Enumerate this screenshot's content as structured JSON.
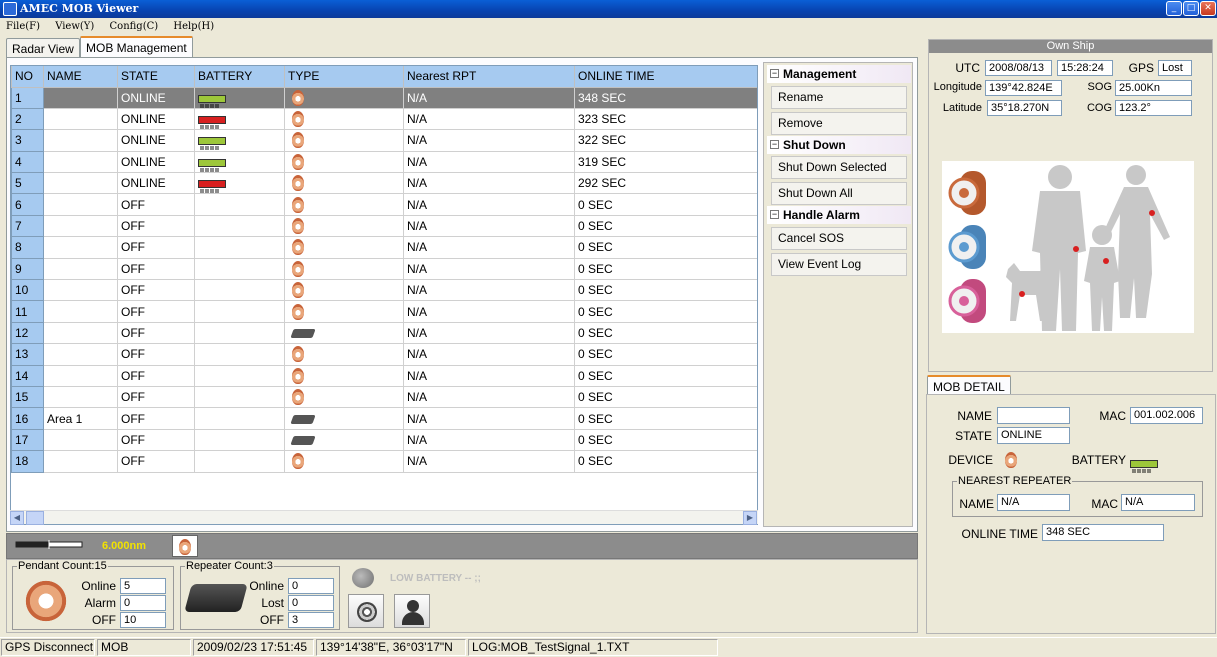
{
  "window": {
    "title": "AMEC MOB Viewer"
  },
  "menu": [
    "File(F)",
    "View(Y)",
    "Config(C)",
    "Help(H)"
  ],
  "tabs": [
    "Radar View",
    "MOB Management"
  ],
  "table": {
    "columns": [
      "NO",
      "NAME",
      "STATE",
      "BATTERY",
      "TYPE",
      "Nearest RPT",
      "ONLINE TIME"
    ],
    "rows": [
      {
        "no": "1",
        "name": "",
        "state": "ONLINE",
        "battery": "good",
        "type": "pendant",
        "rpt": "N/A",
        "time": "348 SEC"
      },
      {
        "no": "2",
        "name": "",
        "state": "ONLINE",
        "battery": "low",
        "type": "pendant",
        "rpt": "N/A",
        "time": "323 SEC"
      },
      {
        "no": "3",
        "name": "",
        "state": "ONLINE",
        "battery": "good",
        "type": "pendant",
        "rpt": "N/A",
        "time": "322 SEC"
      },
      {
        "no": "4",
        "name": "",
        "state": "ONLINE",
        "battery": "good",
        "type": "pendant",
        "rpt": "N/A",
        "time": "319 SEC"
      },
      {
        "no": "5",
        "name": "",
        "state": "ONLINE",
        "battery": "low",
        "type": "pendant",
        "rpt": "N/A",
        "time": "292 SEC"
      },
      {
        "no": "6",
        "name": "",
        "state": "OFF",
        "battery": "",
        "type": "pendant",
        "rpt": "N/A",
        "time": "0 SEC"
      },
      {
        "no": "7",
        "name": "",
        "state": "OFF",
        "battery": "",
        "type": "pendant",
        "rpt": "N/A",
        "time": "0 SEC"
      },
      {
        "no": "8",
        "name": "",
        "state": "OFF",
        "battery": "",
        "type": "pendant",
        "rpt": "N/A",
        "time": "0 SEC"
      },
      {
        "no": "9",
        "name": "",
        "state": "OFF",
        "battery": "",
        "type": "pendant",
        "rpt": "N/A",
        "time": "0 SEC"
      },
      {
        "no": "10",
        "name": "",
        "state": "OFF",
        "battery": "",
        "type": "pendant",
        "rpt": "N/A",
        "time": "0 SEC"
      },
      {
        "no": "11",
        "name": "",
        "state": "OFF",
        "battery": "",
        "type": "pendant",
        "rpt": "N/A",
        "time": "0 SEC"
      },
      {
        "no": "12",
        "name": "",
        "state": "OFF",
        "battery": "",
        "type": "repeater",
        "rpt": "N/A",
        "time": "0 SEC"
      },
      {
        "no": "13",
        "name": "",
        "state": "OFF",
        "battery": "",
        "type": "pendant",
        "rpt": "N/A",
        "time": "0 SEC"
      },
      {
        "no": "14",
        "name": "",
        "state": "OFF",
        "battery": "",
        "type": "pendant",
        "rpt": "N/A",
        "time": "0 SEC"
      },
      {
        "no": "15",
        "name": "",
        "state": "OFF",
        "battery": "",
        "type": "pendant",
        "rpt": "N/A",
        "time": "0 SEC"
      },
      {
        "no": "16",
        "name": "Area 1",
        "state": "OFF",
        "battery": "",
        "type": "repeater",
        "rpt": "N/A",
        "time": "0 SEC"
      },
      {
        "no": "17",
        "name": "",
        "state": "OFF",
        "battery": "",
        "type": "repeater",
        "rpt": "N/A",
        "time": "0 SEC"
      },
      {
        "no": "18",
        "name": "",
        "state": "OFF",
        "battery": "",
        "type": "pendant",
        "rpt": "N/A",
        "time": "0 SEC"
      }
    ]
  },
  "actions": {
    "management": {
      "title": "Management",
      "rename": "Rename",
      "remove": "Remove"
    },
    "shutdown": {
      "title": "Shut Down",
      "selected": "Shut Down Selected",
      "all": "Shut Down All"
    },
    "alarm": {
      "title": "Handle Alarm",
      "cancel": "Cancel SOS",
      "log": "View Event Log"
    }
  },
  "ruler": {
    "range": "6.000nm"
  },
  "pendant_count": {
    "title": "Pendant Count:15",
    "online_label": "Online",
    "online": "5",
    "alarm_label": "Alarm",
    "alarm": "0",
    "off_label": "OFF",
    "off": "10"
  },
  "repeater_count": {
    "title": "Repeater Count:3",
    "online_label": "Online",
    "online": "0",
    "lost_label": "Lost",
    "lost": "0",
    "off_label": "OFF",
    "off": "3"
  },
  "low_battery": "LOW BATTERY -- ;;",
  "own_ship": {
    "title": "Own Ship",
    "utc_label": "UTC",
    "utc_date": "2008/08/13",
    "utc_time": "15:28:24",
    "gps_label": "GPS",
    "gps": "Lost",
    "lon_label": "Longitude",
    "lon": "139°42.824E",
    "sog_label": "SOG",
    "sog": "25.00Kn",
    "lat_label": "Latitude",
    "lat": "35°18.270N",
    "cog_label": "COG",
    "cog": "123.2°"
  },
  "mob_detail": {
    "tab": "MOB DETAIL",
    "name_label": "NAME",
    "name": "",
    "mac_label": "MAC",
    "mac": "001.002.006",
    "state_label": "STATE",
    "state": "ONLINE",
    "device_label": "DEVICE",
    "battery_label": "BATTERY",
    "repeater_legend": "NEAREST REPEATER",
    "rpt_name_label": "NAME",
    "rpt_name": "N/A",
    "rpt_mac_label": "MAC",
    "rpt_mac": "N/A",
    "online_label": "ONLINE TIME",
    "online_time": "348 SEC"
  },
  "statusbar": [
    "GPS Disconnect",
    "MOB Disconnect",
    "2009/02/23 17:51:45",
    "139°14'38\"E, 36°03'17\"N",
    "LOG:MOB_TestSignal_1.TXT"
  ],
  "colors": {
    "title": "#0843b0",
    "header": "#a6caf0",
    "selected_row": "#808080",
    "battery_good": "#9dc73a",
    "battery_low": "#d82020",
    "range_text": "#f2e200"
  }
}
